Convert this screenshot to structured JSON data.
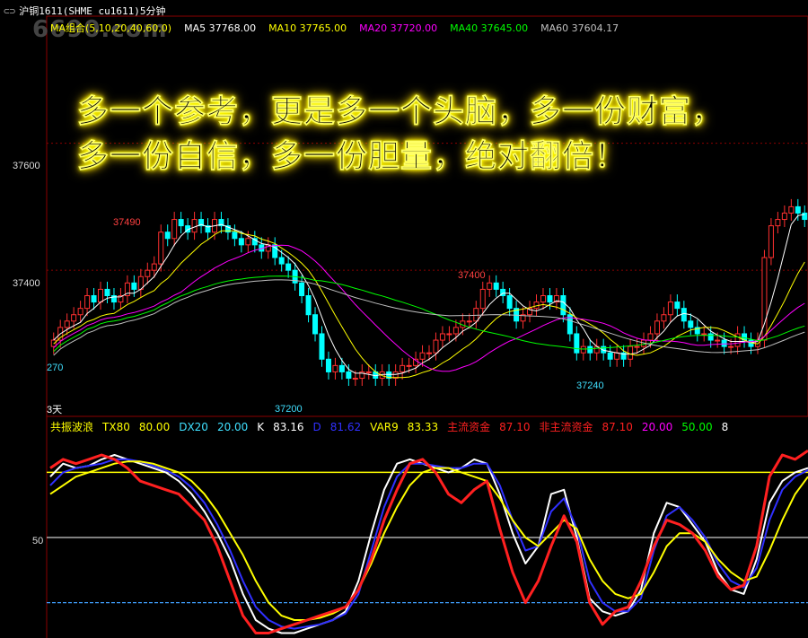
{
  "window": {
    "title_symbol": "沪铜1611(SHME cu1611)5分钟",
    "title_icon": "⊂⊃"
  },
  "watermark": "6690.com",
  "overlay_text": [
    "多一个参考，更是多一个头脑，多一份财富，",
    "多一份自信，多一份胆量，绝对翻倍！"
  ],
  "price_panel": {
    "legend": [
      {
        "label": "MA组合(5,10,20,40,60,0)",
        "color": "#ffff00"
      },
      {
        "label": "MA5 37768.00",
        "color": "#ffffff"
      },
      {
        "label": "MA10 37765.00",
        "color": "#ffff00"
      },
      {
        "label": "MA20 37720.00",
        "color": "#ff00ff"
      },
      {
        "label": "MA40 37645.00",
        "color": "#00ff00"
      },
      {
        "label": "MA60 37604.17",
        "color": "#c0c0c0"
      }
    ],
    "y_ticks": [
      "37600",
      "37400"
    ],
    "annotations": [
      {
        "text": "37490",
        "color": "#ff4040"
      },
      {
        "text": "37400",
        "color": "#ff4040"
      },
      {
        "text": "37200",
        "color": "#40e0ff"
      },
      {
        "text": "37240",
        "color": "#40e0ff"
      },
      {
        "text": "270",
        "color": "#40e0ff"
      },
      {
        "text": "3天",
        "color": "#ffffff"
      }
    ]
  },
  "indicator_panel": {
    "items": [
      {
        "label": "共振波浪",
        "color": "#ffff00"
      },
      {
        "label": "TX80",
        "color": "#ffff00"
      },
      {
        "label": "80.00",
        "color": "#ffff00"
      },
      {
        "label": "DX20",
        "color": "#40e0ff"
      },
      {
        "label": "20.00",
        "color": "#40e0ff"
      },
      {
        "label": "K",
        "color": "#ffffff"
      },
      {
        "label": "83.16",
        "color": "#ffffff"
      },
      {
        "label": "D",
        "color": "#3030ff"
      },
      {
        "label": "81.62",
        "color": "#3030ff"
      },
      {
        "label": "VAR9",
        "color": "#ffff00"
      },
      {
        "label": "83.33",
        "color": "#ffff00"
      },
      {
        "label": "主流资金",
        "color": "#ff2020"
      },
      {
        "label": "87.10",
        "color": "#ff2020"
      },
      {
        "label": "非主流资金",
        "color": "#ff2020"
      },
      {
        "label": "87.10",
        "color": "#ff2020"
      },
      {
        "label": "20.00",
        "color": "#ff00ff"
      },
      {
        "label": "50.00",
        "color": "#00ff00"
      },
      {
        "label": "8",
        "color": "#ffffff"
      }
    ],
    "y_ticks": [
      "50"
    ]
  },
  "chart_data": [
    {
      "type": "candlestick",
      "title": "沪铜1611(SHME cu1611)5分钟",
      "ylim": [
        37170,
        37800
      ],
      "close": [
        37290,
        37310,
        37320,
        37330,
        37340,
        37360,
        37350,
        37370,
        37360,
        37350,
        37360,
        37380,
        37370,
        37390,
        37400,
        37410,
        37460,
        37450,
        37480,
        37470,
        37460,
        37480,
        37470,
        37460,
        37480,
        37470,
        37460,
        37450,
        37440,
        37450,
        37440,
        37430,
        37440,
        37420,
        37410,
        37400,
        37380,
        37360,
        37330,
        37300,
        37260,
        37240,
        37250,
        37240,
        37230,
        37230,
        37240,
        37240,
        37230,
        37240,
        37230,
        37240,
        37250,
        37250,
        37260,
        37270,
        37270,
        37290,
        37300,
        37300,
        37310,
        37320,
        37320,
        37340,
        37370,
        37380,
        37370,
        37360,
        37340,
        37320,
        37330,
        37340,
        37350,
        37360,
        37350,
        37360,
        37330,
        37300,
        37270,
        37280,
        37270,
        37280,
        37270,
        37260,
        37270,
        37260,
        37280,
        37280,
        37290,
        37300,
        37320,
        37330,
        37350,
        37340,
        37320,
        37310,
        37300,
        37300,
        37290,
        37290,
        37280,
        37280,
        37300,
        37290,
        37280,
        37290,
        37420,
        37470,
        37480,
        37490,
        37500,
        37490,
        37480
      ],
      "series": [
        {
          "name": "MA5"
        },
        {
          "name": "MA10"
        },
        {
          "name": "MA20"
        },
        {
          "name": "MA40"
        },
        {
          "name": "MA60"
        }
      ]
    },
    {
      "type": "line",
      "ylim": [
        0,
        100
      ],
      "y_ticks": [
        50
      ],
      "hlines": [
        80,
        20
      ],
      "series": [
        {
          "name": "K",
          "color": "#ffffff",
          "values": [
            78,
            84,
            82,
            83,
            86,
            88,
            86,
            84,
            82,
            80,
            76,
            70,
            62,
            52,
            40,
            24,
            12,
            8,
            6,
            6,
            8,
            10,
            12,
            16,
            30,
            52,
            72,
            84,
            86,
            84,
            82,
            80,
            82,
            86,
            84,
            70,
            52,
            38,
            46,
            70,
            72,
            50,
            22,
            16,
            14,
            16,
            26,
            52,
            66,
            64,
            56,
            48,
            34,
            26,
            24,
            40,
            66,
            76,
            80,
            82
          ]
        },
        {
          "name": "D",
          "color": "#3030ff",
          "values": [
            74,
            80,
            82,
            83,
            84,
            86,
            86,
            85,
            83,
            81,
            78,
            73,
            66,
            56,
            44,
            30,
            18,
            12,
            9,
            8,
            9,
            10,
            12,
            15,
            24,
            44,
            64,
            78,
            84,
            84,
            83,
            82,
            82,
            84,
            84,
            74,
            58,
            44,
            46,
            62,
            68,
            54,
            30,
            20,
            16,
            16,
            22,
            44,
            60,
            64,
            58,
            50,
            38,
            30,
            27,
            36,
            58,
            72,
            78,
            81
          ]
        },
        {
          "name": "VAR9",
          "color": "#ffff00",
          "values": [
            70,
            74,
            78,
            80,
            82,
            84,
            85,
            85,
            84,
            82,
            80,
            76,
            70,
            62,
            52,
            42,
            30,
            20,
            14,
            12,
            12,
            13,
            15,
            18,
            26,
            38,
            52,
            64,
            74,
            80,
            82,
            82,
            80,
            78,
            76,
            68,
            58,
            50,
            46,
            52,
            58,
            54,
            40,
            30,
            24,
            22,
            24,
            34,
            46,
            52,
            52,
            48,
            40,
            34,
            30,
            32,
            44,
            58,
            70,
            78
          ]
        },
        {
          "name": "主流资金",
          "color": "#ff2020",
          "values": [
            82,
            86,
            84,
            86,
            88,
            86,
            82,
            76,
            74,
            72,
            70,
            64,
            58,
            46,
            30,
            14,
            6,
            6,
            8,
            10,
            12,
            14,
            16,
            18,
            26,
            40,
            58,
            72,
            84,
            86,
            80,
            70,
            66,
            72,
            76,
            54,
            34,
            20,
            30,
            46,
            60,
            48,
            20,
            10,
            16,
            18,
            30,
            46,
            58,
            56,
            52,
            44,
            32,
            26,
            28,
            46,
            78,
            88,
            86,
            90
          ]
        }
      ]
    }
  ]
}
